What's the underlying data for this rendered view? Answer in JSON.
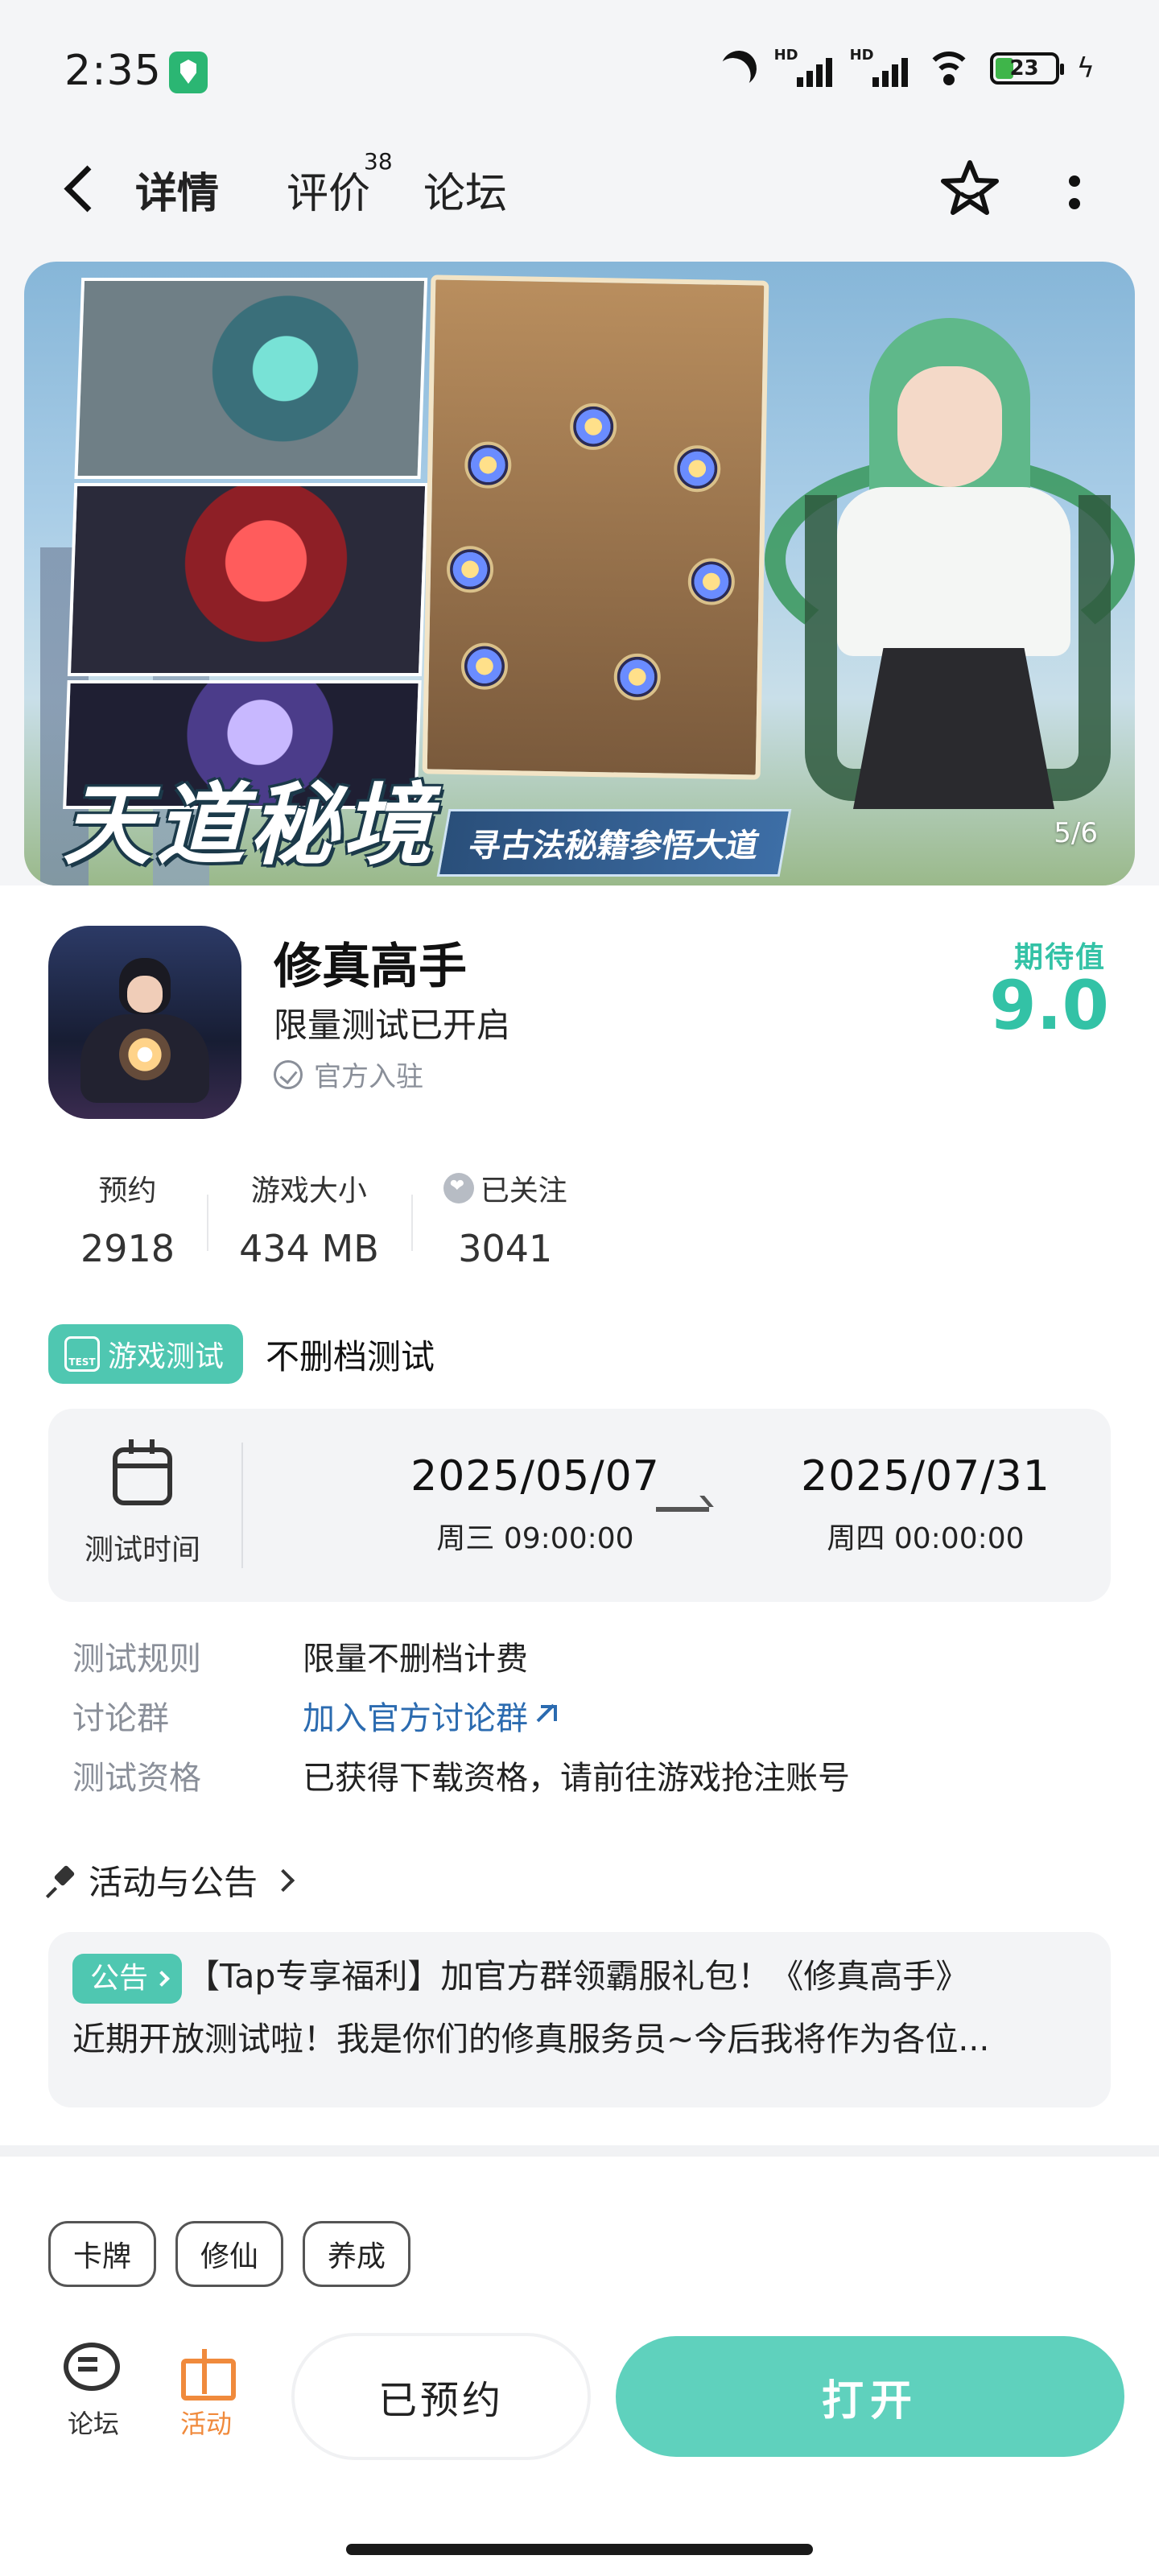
{
  "status_bar": {
    "time": "2:35",
    "battery": "23"
  },
  "nav": {
    "tabs": [
      {
        "label": "详情",
        "active": true
      },
      {
        "label": "评价",
        "badge": "38"
      },
      {
        "label": "论坛"
      }
    ]
  },
  "banner": {
    "title": "天道秘境",
    "subtitle": "寻古法秘籍参悟大道",
    "counter": "5/6"
  },
  "app": {
    "name": "修真高手",
    "tagline": "限量测试已开启",
    "official_label": "官方入驻",
    "expect_label": "期待值",
    "expect_value": "9.0",
    "accent_color": "#33c2a6"
  },
  "stats": [
    {
      "label": "预约",
      "value": "2918"
    },
    {
      "label": "游戏大小",
      "value": "434 MB"
    },
    {
      "label": "已关注",
      "value": "3041"
    }
  ],
  "test": {
    "badge": "游戏测试",
    "badge_icon_text": "TEST",
    "type": "不删档测试",
    "time_label": "测试时间",
    "start": {
      "date": "2025/05/07",
      "detail": "周三  09:00:00"
    },
    "end": {
      "date": "2025/07/31",
      "detail": "周四  00:00:00"
    }
  },
  "info": {
    "rules_key": "测试规则",
    "rules_val": "限量不删档计费",
    "group_key": "讨论群",
    "group_val": "加入官方讨论群",
    "qual_key": "测试资格",
    "qual_val": "已获得下载资格，请前往游戏抢注账号"
  },
  "activity": {
    "title": "活动与公告",
    "notice_badge": "公告",
    "notice_line1": "【Tap专享福利】加官方群领霸服礼包！《修真高手》",
    "notice_line2": "近期开放测试啦！我是你们的修真服务员~今后我将作为各位..."
  },
  "tags": [
    "卡牌",
    "修仙",
    "养成"
  ],
  "bottom": {
    "forum": "论坛",
    "activity": "活动",
    "reserved": "已预约",
    "open": "打开"
  }
}
